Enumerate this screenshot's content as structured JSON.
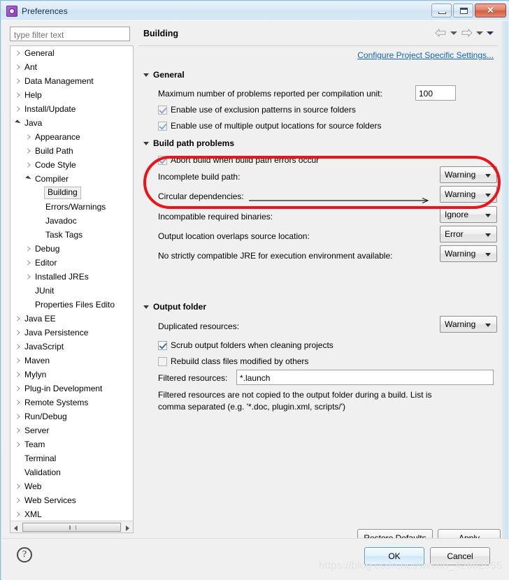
{
  "window": {
    "title": "Preferences",
    "icon": "preferences-gear-icon",
    "controls": {
      "minimize": "minimize-icon",
      "maximize": "maximize-icon",
      "close": "✕"
    }
  },
  "sidebar": {
    "filter_placeholder": "type filter text",
    "filter_value": "",
    "items": [
      {
        "label": "General",
        "indent": 0,
        "twisty": "collapsed",
        "selected": false
      },
      {
        "label": "Ant",
        "indent": 0,
        "twisty": "collapsed",
        "selected": false
      },
      {
        "label": "Data Management",
        "indent": 0,
        "twisty": "collapsed",
        "selected": false
      },
      {
        "label": "Help",
        "indent": 0,
        "twisty": "collapsed",
        "selected": false
      },
      {
        "label": "Install/Update",
        "indent": 0,
        "twisty": "collapsed",
        "selected": false
      },
      {
        "label": "Java",
        "indent": 0,
        "twisty": "expanded",
        "selected": false
      },
      {
        "label": "Appearance",
        "indent": 1,
        "twisty": "collapsed",
        "selected": false
      },
      {
        "label": "Build Path",
        "indent": 1,
        "twisty": "collapsed",
        "selected": false
      },
      {
        "label": "Code Style",
        "indent": 1,
        "twisty": "collapsed",
        "selected": false
      },
      {
        "label": "Compiler",
        "indent": 1,
        "twisty": "expanded",
        "selected": false
      },
      {
        "label": "Building",
        "indent": 2,
        "twisty": "none",
        "selected": true
      },
      {
        "label": "Errors/Warnings",
        "indent": 2,
        "twisty": "none",
        "selected": false
      },
      {
        "label": "Javadoc",
        "indent": 2,
        "twisty": "none",
        "selected": false
      },
      {
        "label": "Task Tags",
        "indent": 2,
        "twisty": "none",
        "selected": false
      },
      {
        "label": "Debug",
        "indent": 1,
        "twisty": "collapsed",
        "selected": false
      },
      {
        "label": "Editor",
        "indent": 1,
        "twisty": "collapsed",
        "selected": false
      },
      {
        "label": "Installed JREs",
        "indent": 1,
        "twisty": "collapsed",
        "selected": false
      },
      {
        "label": "JUnit",
        "indent": 1,
        "twisty": "none",
        "selected": false
      },
      {
        "label": "Properties Files Edito",
        "indent": 1,
        "twisty": "none",
        "selected": false
      },
      {
        "label": "Java EE",
        "indent": 0,
        "twisty": "collapsed",
        "selected": false
      },
      {
        "label": "Java Persistence",
        "indent": 0,
        "twisty": "collapsed",
        "selected": false
      },
      {
        "label": "JavaScript",
        "indent": 0,
        "twisty": "collapsed",
        "selected": false
      },
      {
        "label": "Maven",
        "indent": 0,
        "twisty": "collapsed",
        "selected": false
      },
      {
        "label": "Mylyn",
        "indent": 0,
        "twisty": "collapsed",
        "selected": false
      },
      {
        "label": "Plug-in Development",
        "indent": 0,
        "twisty": "collapsed",
        "selected": false
      },
      {
        "label": "Remote Systems",
        "indent": 0,
        "twisty": "collapsed",
        "selected": false
      },
      {
        "label": "Run/Debug",
        "indent": 0,
        "twisty": "collapsed",
        "selected": false
      },
      {
        "label": "Server",
        "indent": 0,
        "twisty": "collapsed",
        "selected": false
      },
      {
        "label": "Team",
        "indent": 0,
        "twisty": "collapsed",
        "selected": false
      },
      {
        "label": "Terminal",
        "indent": 0,
        "twisty": "none",
        "selected": false
      },
      {
        "label": "Validation",
        "indent": 0,
        "twisty": "none",
        "selected": false
      },
      {
        "label": "Web",
        "indent": 0,
        "twisty": "collapsed",
        "selected": false
      },
      {
        "label": "Web Services",
        "indent": 0,
        "twisty": "collapsed",
        "selected": false
      },
      {
        "label": "XML",
        "indent": 0,
        "twisty": "collapsed",
        "selected": false
      }
    ]
  },
  "page": {
    "title": "Building",
    "project_specific_link": "Configure Project Specific Settings...",
    "nav": {
      "back": "back-arrow-icon",
      "back_menu": "chevron-down-icon",
      "forward": "forward-arrow-icon",
      "forward_menu": "chevron-down-icon",
      "view_menu": "chevron-down-icon"
    },
    "general": {
      "heading": "General",
      "max_problems_label": "Maximum number of problems reported per compilation unit:",
      "max_problems_value": "100",
      "checkbox_exclusion": "Enable use of exclusion patterns in source folders",
      "checkbox_exclusion_checked": true,
      "checkbox_multiple_output": "Enable use of multiple output locations for source folders",
      "checkbox_multiple_output_checked": true
    },
    "build_path_problems": {
      "heading": "Build path problems",
      "abort_label": "Abort build when build path errors occur",
      "abort_checked": true,
      "rows": [
        {
          "label": "Incomplete build path:",
          "value": "Warning"
        },
        {
          "label": "Circular dependencies:",
          "value": "Warning"
        },
        {
          "label": "Incompatible required binaries:",
          "value": "Ignore"
        },
        {
          "label": "Output location overlaps source location:",
          "value": "Error"
        },
        {
          "label": "No strictly compatible JRE for execution environment available:",
          "value": "Warning"
        }
      ]
    },
    "output_folder": {
      "heading": "Output folder",
      "duplicated_label": "Duplicated resources:",
      "duplicated_value": "Warning",
      "scrub_label": "Scrub output folders when cleaning projects",
      "scrub_checked": true,
      "rebuild_label": "Rebuild class files modified by others",
      "rebuild_checked": false,
      "filtered_label": "Filtered resources:",
      "filtered_value": "*.launch",
      "help_text": "Filtered resources are not copied to the output folder during a build. List is comma separated (e.g. '*.doc, plugin.xml, scripts/')"
    },
    "buttons": {
      "restore_defaults": "Restore Defaults",
      "apply": "Apply"
    }
  },
  "footer": {
    "help_icon": "?",
    "ok": "OK",
    "cancel": "Cancel"
  },
  "annotation": {
    "highlight_color": "#e8161a",
    "type": "rounded-rectangle-callout"
  },
  "watermark": "https://blog.csdn.net/weixin_42662955"
}
